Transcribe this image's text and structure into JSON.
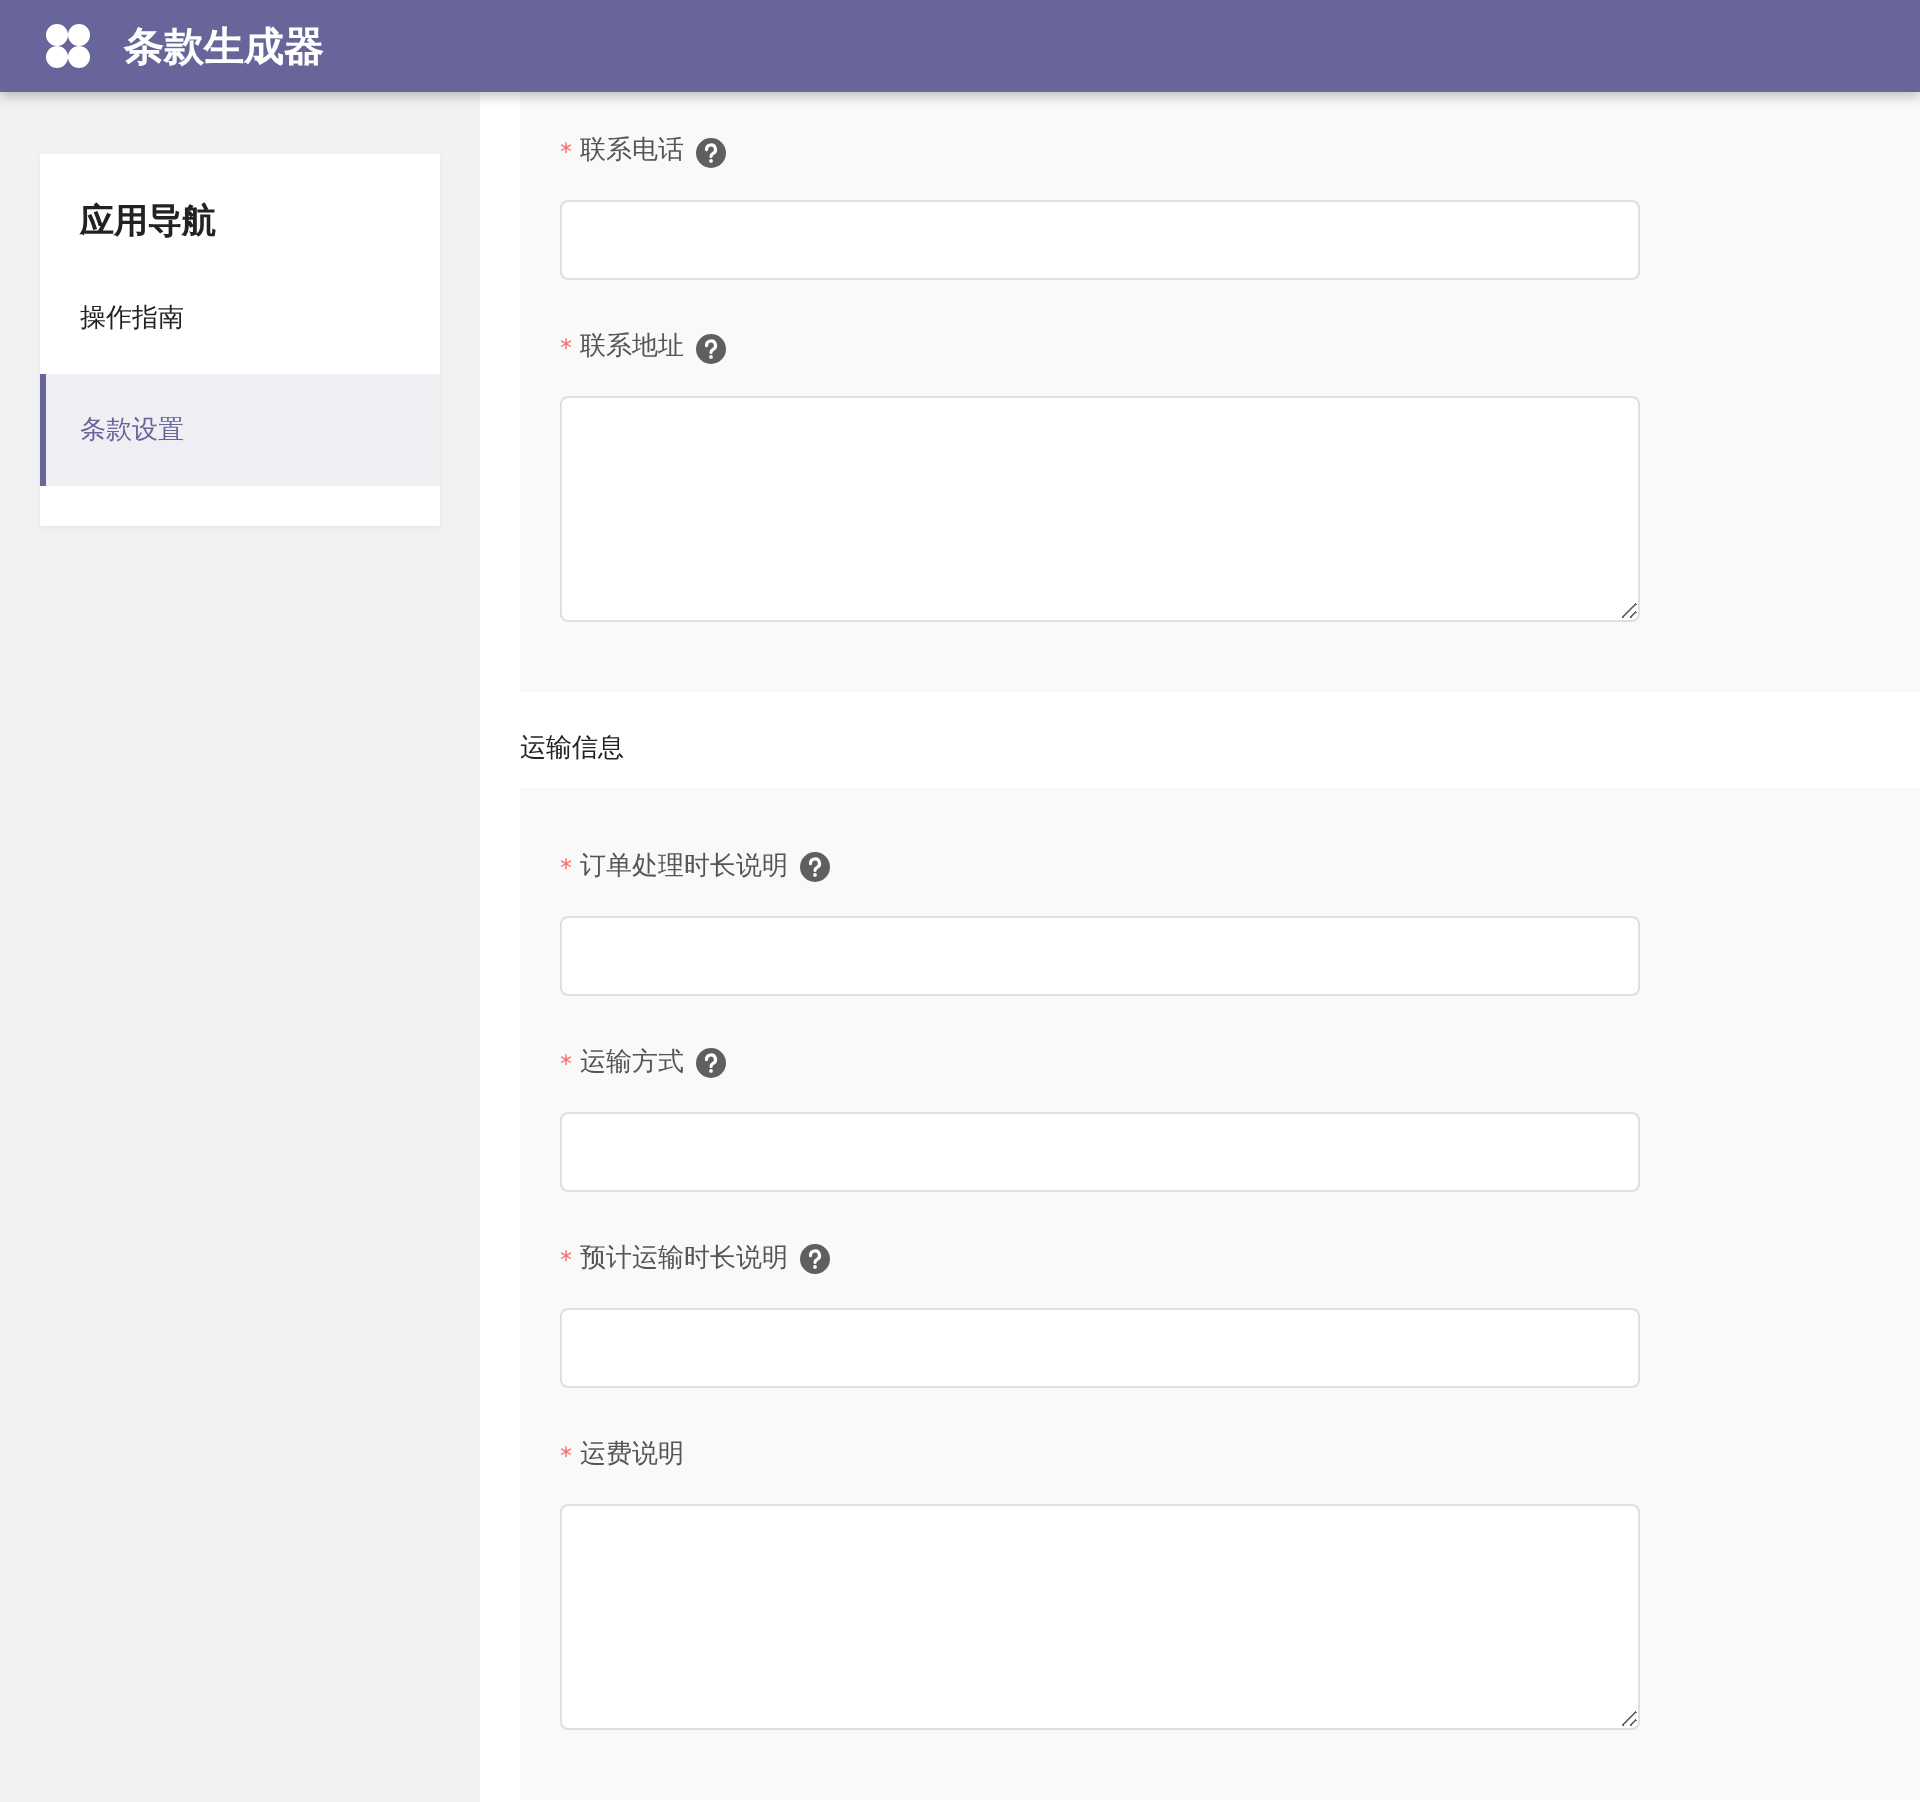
{
  "header": {
    "title": "条款生成器"
  },
  "sidebar": {
    "title": "应用导航",
    "items": [
      {
        "label": "操作指南",
        "selected": false
      },
      {
        "label": "条款设置",
        "selected": true
      }
    ]
  },
  "sections": [
    {
      "fields": [
        {
          "kind": "input",
          "required_mark": "*",
          "label": "联系电话",
          "help": true
        },
        {
          "kind": "textarea",
          "required_mark": "*",
          "label": "联系地址",
          "help": true
        }
      ]
    },
    {
      "title": "运输信息",
      "fields": [
        {
          "kind": "input",
          "required_mark": "*",
          "label": "订单处理时长说明",
          "help": true
        },
        {
          "kind": "input",
          "required_mark": "*",
          "label": "运输方式",
          "help": true
        },
        {
          "kind": "input",
          "required_mark": "*",
          "label": "预计运输时长说明",
          "help": true
        },
        {
          "kind": "textarea",
          "required_mark": "*",
          "label": "运费说明",
          "help": false
        }
      ]
    }
  ]
}
